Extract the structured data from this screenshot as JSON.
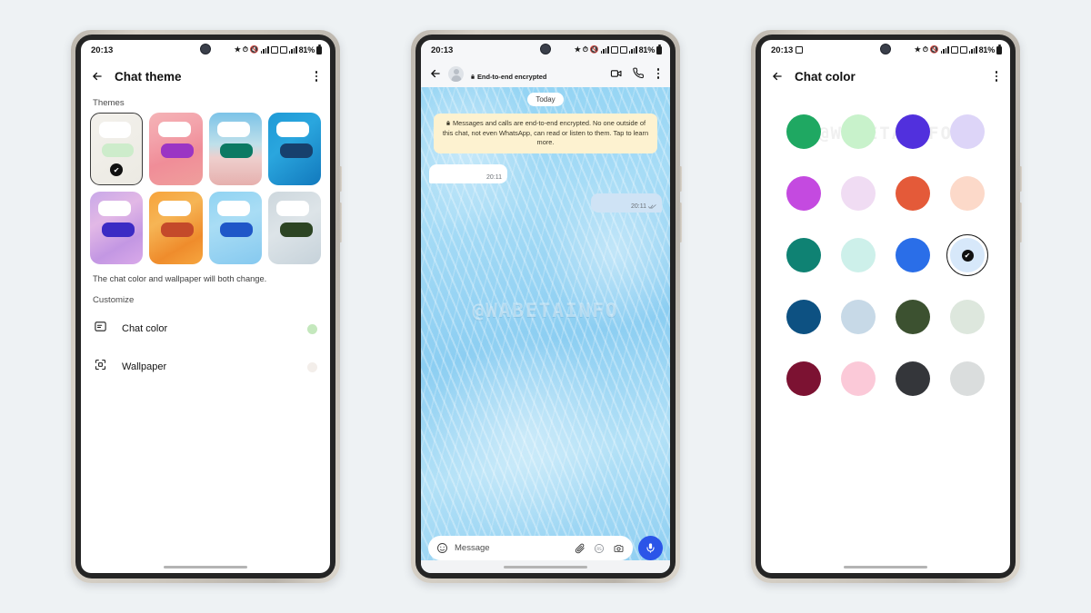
{
  "status_bar": {
    "time": "20:13",
    "battery": "81%",
    "icons": [
      "star-icon",
      "alarm-icon",
      "mute-icon",
      "signal-bars-icon",
      "nfc-icon",
      "wifi-icon",
      "signal-bars-icon",
      "battery-icon"
    ],
    "phone3_extra_icon": "screenshot-icon"
  },
  "phone1": {
    "appbar": {
      "title": "Chat theme",
      "back": "back-arrow",
      "menu": "more-options"
    },
    "themes_label": "Themes",
    "themes": [
      {
        "name": "cream-paper",
        "selected": true,
        "bg": "linear-gradient(145deg,#f3f1ec,#eceae3)",
        "bubble_out": "#cdeccb"
      },
      {
        "name": "coral-flowers",
        "selected": false,
        "bg": "linear-gradient(160deg,#f5b3b6 0%,#f3a3ab 30%,#f08d98 60%,#ef9f9c 100%)",
        "bubble_out": "#9b35c4"
      },
      {
        "name": "beach",
        "selected": false,
        "bg": "linear-gradient(180deg,#7cc3e8 0%,#bfe0ea 44%,#eecfcd 62%,#e6b0ae 100%)",
        "bubble_out": "#0b7a63"
      },
      {
        "name": "blue-lines",
        "selected": false,
        "bg": "linear-gradient(140deg,#1f9ad6 0%,#2aa6de 40%,#1279bd 100%)",
        "bubble_out": "#17406d"
      },
      {
        "name": "lilac-aurora",
        "selected": false,
        "bg": "linear-gradient(150deg,#c8a8e8 0%,#e2b8e6 35%,#c397e3 70%,#d9a9e9 100%)",
        "bubble_out": "#3b2bc4"
      },
      {
        "name": "orange-silk",
        "selected": false,
        "bg": "linear-gradient(150deg,#f7a33b 0%,#f6b555 35%,#ef8c2c 72%,#f6a63f 100%)",
        "bubble_out": "#c44a2a"
      },
      {
        "name": "ice-blue",
        "selected": false,
        "bg": "linear-gradient(160deg,#90d3f2 0%,#a9ddf5 40%,#86c9ef 100%)",
        "bubble_out": "#1f57c8"
      },
      {
        "name": "leaves-sky",
        "selected": false,
        "bg": "linear-gradient(150deg,#cdd7dd 0%,#dde4e8 45%,#c6d2da 100%)",
        "bubble_out": "#2c4423"
      }
    ],
    "hint": "The chat color and wallpaper will both change.",
    "customize_label": "Customize",
    "rows": [
      {
        "name": "chat-color",
        "label": "Chat color",
        "icon": "chat-color-icon",
        "swatch": "#c4e8bd"
      },
      {
        "name": "wallpaper",
        "label": "Wallpaper",
        "icon": "wallpaper-icon",
        "swatch": "#f3eeea"
      }
    ]
  },
  "phone2": {
    "header": {
      "encrypted_label": "End-to-end encrypted",
      "video_icon": "video-call-icon",
      "call_icon": "voice-call-icon",
      "menu_icon": "more-options-icon",
      "avatar": "contact-avatar"
    },
    "day_divider": "Today",
    "encryption_notice": "Messages and calls are end-to-end encrypted. No one outside of this chat, not even WhatsApp, can read or listen to them. Tap to learn more.",
    "messages": [
      {
        "direction": "incoming",
        "time": "20:11",
        "status": ""
      },
      {
        "direction": "outgoing",
        "time": "20:11",
        "status": "read-receipt-double-check"
      }
    ],
    "watermark": "@WABETAINFO",
    "composer": {
      "placeholder": "Message",
      "emoji_icon": "emoji-icon",
      "attach_icon": "attachment-clip-icon",
      "sticker_icon": "sticker-icon",
      "camera_icon": "camera-icon",
      "mic_icon": "microphone-icon",
      "mic_color": "#2b55e8"
    }
  },
  "phone3": {
    "appbar": {
      "title": "Chat color",
      "back": "back-arrow",
      "menu": "more-options"
    },
    "watermark": "@WABETAINFO",
    "colors": [
      {
        "name": "emerald-green",
        "hex": "#1fa862",
        "selected": false
      },
      {
        "name": "mint-pale",
        "hex": "#c8f2cb",
        "selected": false
      },
      {
        "name": "indigo-violet",
        "hex": "#5130dd",
        "selected": false
      },
      {
        "name": "lavender-pale",
        "hex": "#ddd5f8",
        "selected": false
      },
      {
        "name": "orchid-purple",
        "hex": "#c44ae0",
        "selected": false
      },
      {
        "name": "lilac-pale",
        "hex": "#f0dcf3",
        "selected": false
      },
      {
        "name": "terracotta-red",
        "hex": "#e45a39",
        "selected": false
      },
      {
        "name": "peach-pale",
        "hex": "#fcd9c9",
        "selected": false
      },
      {
        "name": "teal-deep",
        "hex": "#0f8273",
        "selected": false
      },
      {
        "name": "aqua-pale",
        "hex": "#cdf0ea",
        "selected": false
      },
      {
        "name": "azure-blue",
        "hex": "#2a6ee8",
        "selected": false
      },
      {
        "name": "sky-pale",
        "hex": "#d7e8fa",
        "selected": true
      },
      {
        "name": "navy-blue",
        "hex": "#0d5182",
        "selected": false
      },
      {
        "name": "powder-blue",
        "hex": "#c7d9e7",
        "selected": false
      },
      {
        "name": "forest-green",
        "hex": "#3c5130",
        "selected": false
      },
      {
        "name": "sage-pale",
        "hex": "#dde7dd",
        "selected": false
      },
      {
        "name": "wine-maroon",
        "hex": "#7c1232",
        "selected": false
      },
      {
        "name": "blush-pink",
        "hex": "#fbc9d8",
        "selected": false
      },
      {
        "name": "charcoal-black",
        "hex": "#34363a",
        "selected": false
      },
      {
        "name": "light-gray",
        "hex": "#dadddd",
        "selected": false
      }
    ],
    "check_glyph": "✔"
  }
}
